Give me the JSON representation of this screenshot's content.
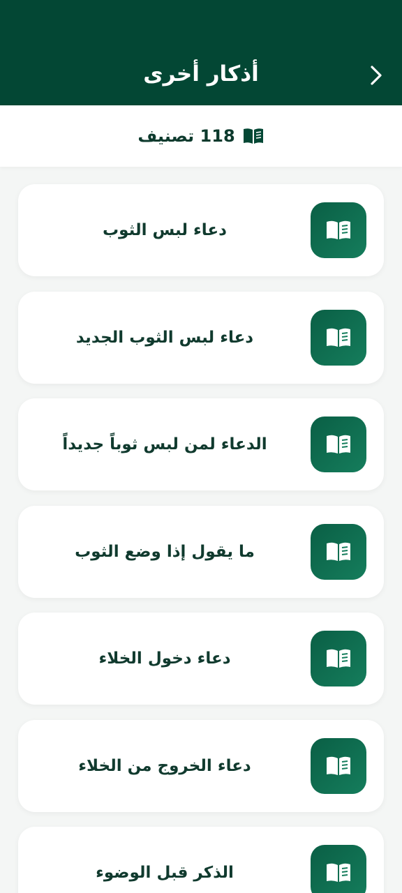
{
  "header": {
    "title": "أذكار أخرى",
    "back_icon": "chevron-right-icon"
  },
  "subheader": {
    "count_label": "118 تصنيف",
    "icon": "book-icon"
  },
  "colors": {
    "primary": "#034734",
    "accent": "#157d5c",
    "card_bg": "#ffffff",
    "page_bg": "#f4f6f5",
    "text": "#103a2e"
  },
  "items": [
    {
      "label": "دعاء لبس الثوب",
      "icon": "book-icon"
    },
    {
      "label": "دعاء لبس الثوب الجديد",
      "icon": "book-icon"
    },
    {
      "label": "الدعاء لمن لبس ثوباً جديداً",
      "icon": "book-icon"
    },
    {
      "label": "ما يقول إذا وضع الثوب",
      "icon": "book-icon"
    },
    {
      "label": "دعاء دخول الخلاء",
      "icon": "book-icon"
    },
    {
      "label": "دعاء الخروج من الخلاء",
      "icon": "book-icon"
    },
    {
      "label": "الذكر قبل الوضوء",
      "icon": "book-icon"
    }
  ]
}
